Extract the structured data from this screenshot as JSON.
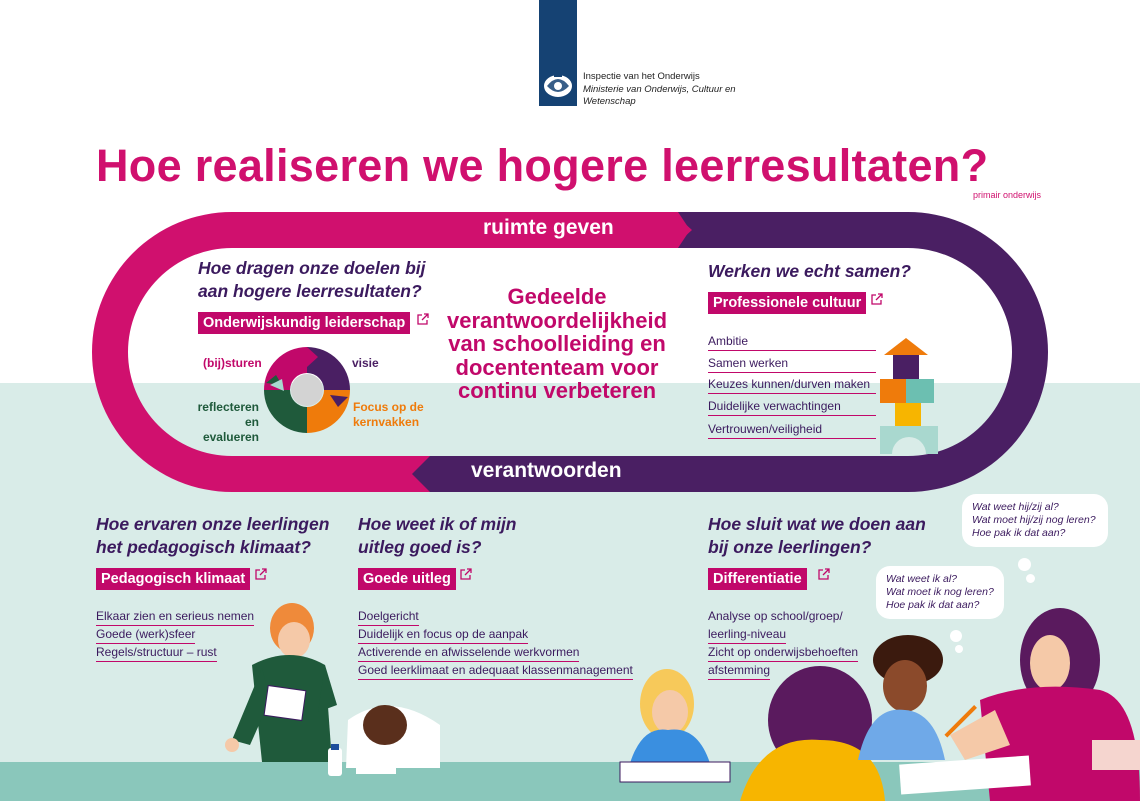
{
  "colors": {
    "magenta": "#c1086a",
    "purple": "#4a1f63",
    "mint": "#d9ece8",
    "green": "#1f5a3b",
    "orange": "#ef7b0b"
  },
  "header": {
    "logo_line1": "Inspectie van het Onderwijs",
    "logo_line2": "Ministerie van Onderwijs, Cultuur en",
    "logo_line3": "Wetenschap"
  },
  "title": "Hoe realiseren we hogere leerresultaten?",
  "subtitle": "primair onderwijs",
  "loop": {
    "top_label": "ruimte geven",
    "bottom_label": "verantwoorden",
    "center_text": "Gedeelde verantwoordelijkheid van schoolleiding en docententeam voor continu verbeteren"
  },
  "leiderschap": {
    "question": "Hoe dragen onze doelen bij aan hogere leerresultaten?",
    "chip": "Onderwijskundig leiderschap",
    "cycle": {
      "sturen": "(bij)sturen",
      "visie": "visie",
      "reflect_line1": "reflecteren en",
      "reflect_line2": "evalueren",
      "focus_line1": "Focus op de",
      "focus_line2": "kernvakken"
    }
  },
  "cultuur": {
    "question": "Werken we echt samen?",
    "chip": "Professionele cultuur",
    "items": [
      "Ambitie",
      "Samen werken",
      "Keuzes kunnen/durven maken",
      "Duidelijke verwachtingen",
      "Vertrouwen/veiligheid"
    ]
  },
  "klimaat": {
    "question": "Hoe ervaren onze leerlingen het pedagogisch klimaat?",
    "chip": "Pedagogisch klimaat",
    "items": [
      "Elkaar zien en serieus nemen",
      "Goede (werk)sfeer",
      "Regels/structuur – rust"
    ]
  },
  "uitleg": {
    "question": "Hoe weet ik of mijn uitleg goed is?",
    "chip": "Goede uitleg",
    "items": [
      "Doelgericht",
      "Duidelijk en focus op de aanpak",
      "Activerende en afwisselende werkvormen",
      "Goed leerklimaat en adequaat klassenmanagement"
    ]
  },
  "differentiatie": {
    "question": "Hoe sluit wat we doen aan bij onze leerlingen?",
    "chip": "Differentiatie",
    "items": [
      "Analyse op school/groep/",
      "leerling-niveau",
      "Zicht op onderwijsbehoeften",
      "afstemming"
    ]
  },
  "bubbles": {
    "teacher": [
      "Wat weet hij/zij al?",
      "Wat moet hij/zij nog leren?",
      "Hoe pak ik dat aan?"
    ],
    "student": [
      "Wat weet ik al?",
      "Wat moet ik nog leren?",
      "Hoe pak ik dat aan?"
    ]
  }
}
